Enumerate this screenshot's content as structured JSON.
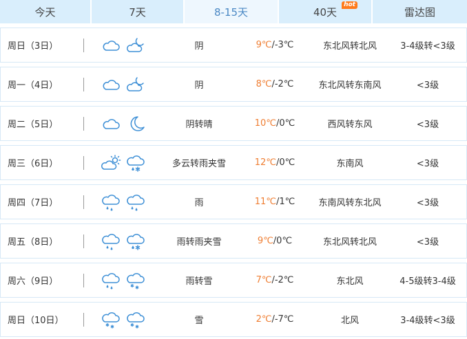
{
  "tabs": [
    {
      "label": "今天",
      "active": false
    },
    {
      "label": "7天",
      "active": false
    },
    {
      "label": "8-15天",
      "active": true
    },
    {
      "label": "40天",
      "active": false,
      "badge": "hot"
    },
    {
      "label": "雷达图",
      "active": false
    }
  ],
  "forecast": [
    {
      "day": "周日（3日）",
      "icons": [
        "cloudy-icon",
        "partly-cloudy-night-icon"
      ],
      "desc": "阴",
      "high": "9℃",
      "low": "/-3℃",
      "wind": "东北风转北风",
      "level": "3-4级转<3级"
    },
    {
      "day": "周一（4日）",
      "icons": [
        "cloudy-icon",
        "partly-cloudy-night-icon"
      ],
      "desc": "阴",
      "high": "8℃",
      "low": "/-2℃",
      "wind": "东北风转东南风",
      "level": "<3级"
    },
    {
      "day": "周二（5日）",
      "icons": [
        "cloudy-icon",
        "moon-icon"
      ],
      "desc": "阴转晴",
      "high": "10℃",
      "low": "/0℃",
      "wind": "西风转东风",
      "level": "<3级"
    },
    {
      "day": "周三（6日）",
      "icons": [
        "partly-cloudy-day-icon",
        "sleet-icon"
      ],
      "desc": "多云转雨夹雪",
      "high": "12℃",
      "low": "/0℃",
      "wind": "东南风",
      "level": "<3级"
    },
    {
      "day": "周四（7日）",
      "icons": [
        "rain-icon",
        "rain-icon"
      ],
      "desc": "雨",
      "high": "11℃",
      "low": "/1℃",
      "wind": "东南风转东北风",
      "level": "<3级"
    },
    {
      "day": "周五（8日）",
      "icons": [
        "rain-icon",
        "sleet-icon"
      ],
      "desc": "雨转雨夹雪",
      "high": "9℃",
      "low": "/0℃",
      "wind": "东北风转北风",
      "level": "<3级"
    },
    {
      "day": "周六（9日）",
      "icons": [
        "rain-icon",
        "snow-icon"
      ],
      "desc": "雨转雪",
      "high": "7℃",
      "low": "/-2℃",
      "wind": "东北风",
      "level": "4-5级转3-4级"
    },
    {
      "day": "周日（10日）",
      "icons": [
        "snow-icon",
        "snow-icon"
      ],
      "desc": "雪",
      "high": "2℃",
      "low": "/-7℃",
      "wind": "北风",
      "level": "3-4级转<3级"
    }
  ],
  "colors": {
    "accent": "#4a88c4",
    "tab_bg": "#d9eefc",
    "temp_high": "#ef7d31",
    "icon_stroke": "#3d8fd6"
  }
}
